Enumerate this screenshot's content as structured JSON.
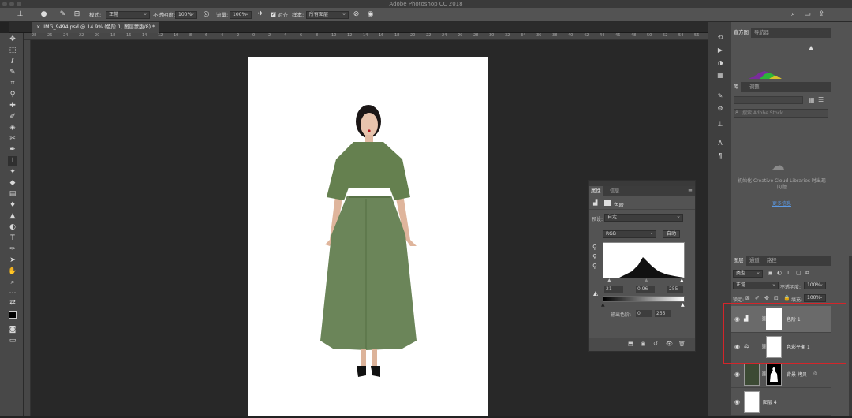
{
  "window": {
    "title": "Adobe Photoshop CC 2018"
  },
  "options": {
    "mode_label": "模式:",
    "mode_value": "正常",
    "opacity_label": "不透明度:",
    "opacity_value": "100%",
    "flow_label": "流量:",
    "flow_value": "100%",
    "align_label": "对齐",
    "sample_label": "样本:",
    "sample_value": "所有图层"
  },
  "document": {
    "tab_title": "IMG_9494.psd @ 14.9% (色阶 1, 图层蒙版/8) *"
  },
  "ruler": {
    "ticks": [
      "28",
      "26",
      "24",
      "22",
      "20",
      "18",
      "16",
      "14",
      "12",
      "10",
      "8",
      "6",
      "4",
      "2",
      "0",
      "2",
      "4",
      "6",
      "8",
      "10",
      "12",
      "14",
      "16",
      "18",
      "20",
      "22",
      "24",
      "26",
      "28",
      "30",
      "32",
      "34",
      "36",
      "38",
      "40",
      "42",
      "44",
      "46",
      "48",
      "50",
      "52",
      "54",
      "56"
    ]
  },
  "histogram_panel": {
    "tabs": [
      "直方图",
      "导航器"
    ]
  },
  "library_panel": {
    "tabs": [
      "库",
      "调整"
    ],
    "search_placeholder": "搜索 Adobe Stock",
    "message": "初始化 Creative Cloud Libraries 时出现问题",
    "link": "更多信息"
  },
  "properties_panel": {
    "tabs": [
      "属性",
      "信息"
    ],
    "header": "色阶",
    "preset_label": "预设:",
    "preset_value": "自定",
    "channel_value": "RGB",
    "auto_button": "自动",
    "input_black": "21",
    "input_gamma": "0.96",
    "input_white": "255",
    "output_label": "输出色阶:",
    "output_black": "0",
    "output_white": "255"
  },
  "layers_panel": {
    "tabs": [
      "图层",
      "通道",
      "路径"
    ],
    "filter_label": "类型",
    "blend_mode": "正常",
    "opacity_label": "不透明度:",
    "opacity_value": "100%",
    "lock_label": "锁定:",
    "fill_label": "填充:",
    "fill_value": "100%",
    "layers": [
      {
        "name": "色阶 1",
        "selected": true
      },
      {
        "name": "色彩平衡 1",
        "selected": false
      },
      {
        "name": "背景 拷贝",
        "selected": false
      },
      {
        "name": "图层 4",
        "selected": false
      }
    ]
  },
  "colors": {
    "dress": "#6b8559",
    "highlight_box": "#d3252a"
  }
}
